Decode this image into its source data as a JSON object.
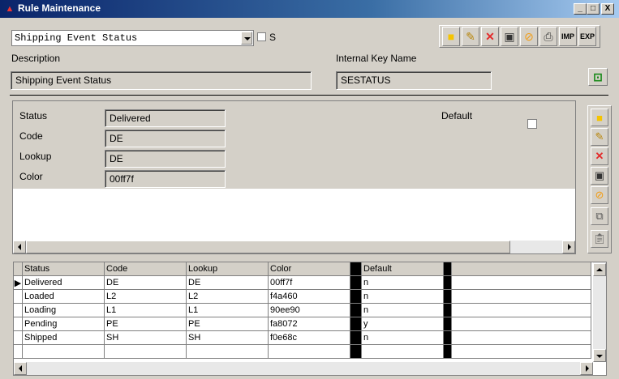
{
  "window": {
    "title": "Rule Maintenance",
    "min_label": "_",
    "max_label": "□",
    "close_label": "X"
  },
  "toolbar": {
    "rule_select_value": "Shipping Event Status",
    "s_checkbox_label": "S",
    "imp_label": "IMP",
    "exp_label": "EXP"
  },
  "header": {
    "description_label": "Description",
    "description_value": "Shipping Event Status",
    "internal_key_label": "Internal Key Name",
    "internal_key_value": "SESTATUS"
  },
  "detail": {
    "status_label": "Status",
    "status_value": "Delivered",
    "code_label": "Code",
    "code_value": "DE",
    "lookup_label": "Lookup",
    "lookup_value": "DE",
    "color_label": "Color",
    "color_value": "00ff7f",
    "default_label": "Default"
  },
  "grid": {
    "columns": [
      "Status",
      "Code",
      "Lookup",
      "Color",
      "Default"
    ],
    "rows": [
      [
        "Delivered",
        "DE",
        "DE",
        "00ff7f",
        "n"
      ],
      [
        "Loaded",
        "L2",
        "L2",
        "f4a460",
        "n"
      ],
      [
        "Loading",
        "L1",
        "L1",
        "90ee90",
        "n"
      ],
      [
        "Pending",
        "PE",
        "PE",
        "fa8072",
        "y"
      ],
      [
        "Shipped",
        "SH",
        "SH",
        "f0e68c",
        "n"
      ]
    ]
  },
  "colors": {
    "titlebar": "#0a246a",
    "face": "#d4d0c8",
    "delete": "#e32b2b",
    "new": "#f5c400",
    "cancel": "#f39c12",
    "lock": "#1a8a1a"
  },
  "icons": [
    "new-icon",
    "edit-icon",
    "delete-icon",
    "save-icon",
    "cancel-icon",
    "print-icon",
    "unlock-icon",
    "copy-icon",
    "paste-icon"
  ]
}
